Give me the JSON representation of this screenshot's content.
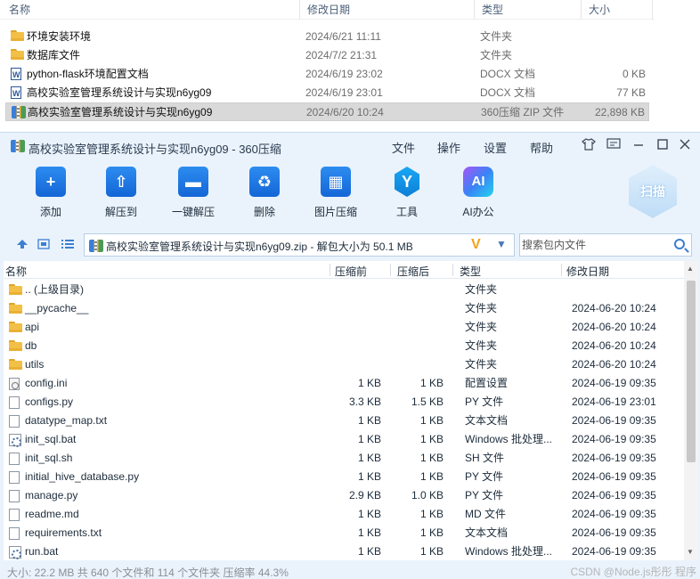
{
  "explorer": {
    "columns": {
      "name": "名称",
      "date": "修改日期",
      "type": "类型",
      "size": "大小"
    },
    "rows": [
      {
        "name": "环境安装环境",
        "date": "2024/6/21 11:11",
        "type": "文件夹",
        "size": "",
        "icon": "folder-icon"
      },
      {
        "name": "数据库文件",
        "date": "2024/7/2 21:31",
        "type": "文件夹",
        "size": "",
        "icon": "folder-icon"
      },
      {
        "name": "python-flask环境配置文档",
        "date": "2024/6/19 23:02",
        "type": "DOCX 文档",
        "size": "0 KB",
        "icon": "docx-icon"
      },
      {
        "name": "高校实验室管理系统设计与实现n6yg09",
        "date": "2024/6/19 23:01",
        "type": "DOCX 文档",
        "size": "77 KB",
        "icon": "docx-icon"
      },
      {
        "name": "高校实验室管理系统设计与实现n6yg09",
        "date": "2024/6/20 10:24",
        "type": "360压缩 ZIP 文件",
        "size": "22,898 KB",
        "icon": "zip-icon"
      }
    ]
  },
  "window": {
    "title": "高校实验室管理系统设计与实现n6yg09 - 360压缩",
    "menu": [
      "文件",
      "操作",
      "设置",
      "帮助"
    ],
    "controls": [
      "shirt-icon",
      "feedback-icon",
      "minimize-icon",
      "maximize-icon",
      "close-icon"
    ]
  },
  "toolbar": {
    "buttons": [
      {
        "label": "添加",
        "icon": "add-folder-icon"
      },
      {
        "label": "解压到",
        "icon": "extract-to-icon"
      },
      {
        "label": "一键解压",
        "icon": "one-click-extract-icon"
      },
      {
        "label": "删除",
        "icon": "delete-icon"
      },
      {
        "label": "图片压缩",
        "icon": "image-compress-icon"
      },
      {
        "label": "工具",
        "icon": "tools-icon"
      },
      {
        "label": "AI办公",
        "icon": "ai-office-icon"
      }
    ],
    "ai_glyph": "AI",
    "scan_label": "扫描"
  },
  "address": {
    "path": "高校实验室管理系统设计与实现n6yg09.zip - 解包大小为 50.1 MB",
    "search_placeholder": "搜索包内文件"
  },
  "filelist": {
    "columns": {
      "name": "名称",
      "compressed": "压缩前",
      "uncompressed": "压缩后",
      "type": "类型",
      "date": "修改日期"
    },
    "rows": [
      {
        "name": ".. (上级目录)",
        "cs": "",
        "us": "",
        "type": "文件夹",
        "date": "",
        "icon": "folder-icon"
      },
      {
        "name": "__pycache__",
        "cs": "",
        "us": "",
        "type": "文件夹",
        "date": "2024-06-20 10:24",
        "icon": "folder-icon"
      },
      {
        "name": "api",
        "cs": "",
        "us": "",
        "type": "文件夹",
        "date": "2024-06-20 10:24",
        "icon": "folder-icon"
      },
      {
        "name": "db",
        "cs": "",
        "us": "",
        "type": "文件夹",
        "date": "2024-06-20 10:24",
        "icon": "folder-icon"
      },
      {
        "name": "utils",
        "cs": "",
        "us": "",
        "type": "文件夹",
        "date": "2024-06-20 10:24",
        "icon": "folder-icon"
      },
      {
        "name": "config.ini",
        "cs": "1 KB",
        "us": "1 KB",
        "type": "配置设置",
        "date": "2024-06-19 09:35",
        "icon": "ini-icon"
      },
      {
        "name": "configs.py",
        "cs": "3.3 KB",
        "us": "1.5 KB",
        "type": "PY 文件",
        "date": "2024-06-19 23:01",
        "icon": "file-icon"
      },
      {
        "name": "datatype_map.txt",
        "cs": "1 KB",
        "us": "1 KB",
        "type": "文本文档",
        "date": "2024-06-19 09:35",
        "icon": "file-icon"
      },
      {
        "name": "init_sql.bat",
        "cs": "1 KB",
        "us": "1 KB",
        "type": "Windows 批处理...",
        "date": "2024-06-19 09:35",
        "icon": "bat-icon"
      },
      {
        "name": "init_sql.sh",
        "cs": "1 KB",
        "us": "1 KB",
        "type": "SH 文件",
        "date": "2024-06-19 09:35",
        "icon": "file-icon"
      },
      {
        "name": "initial_hive_database.py",
        "cs": "1 KB",
        "us": "1 KB",
        "type": "PY 文件",
        "date": "2024-06-19 09:35",
        "icon": "file-icon"
      },
      {
        "name": "manage.py",
        "cs": "2.9 KB",
        "us": "1.0 KB",
        "type": "PY 文件",
        "date": "2024-06-19 09:35",
        "icon": "file-icon"
      },
      {
        "name": "readme.md",
        "cs": "1 KB",
        "us": "1 KB",
        "type": "MD 文件",
        "date": "2024-06-19 09:35",
        "icon": "file-icon"
      },
      {
        "name": "requirements.txt",
        "cs": "1 KB",
        "us": "1 KB",
        "type": "文本文档",
        "date": "2024-06-19 09:35",
        "icon": "file-icon"
      },
      {
        "name": "run.bat",
        "cs": "1 KB",
        "us": "1 KB",
        "type": "Windows 批处理...",
        "date": "2024-06-19 09:35",
        "icon": "bat-icon"
      }
    ]
  },
  "status": {
    "text": "大小: 22.2 MB 共 640 个文件和 114 个文件夹 压缩率 44.3%",
    "watermark": "CSDN @Node.js彤彤  程序"
  }
}
